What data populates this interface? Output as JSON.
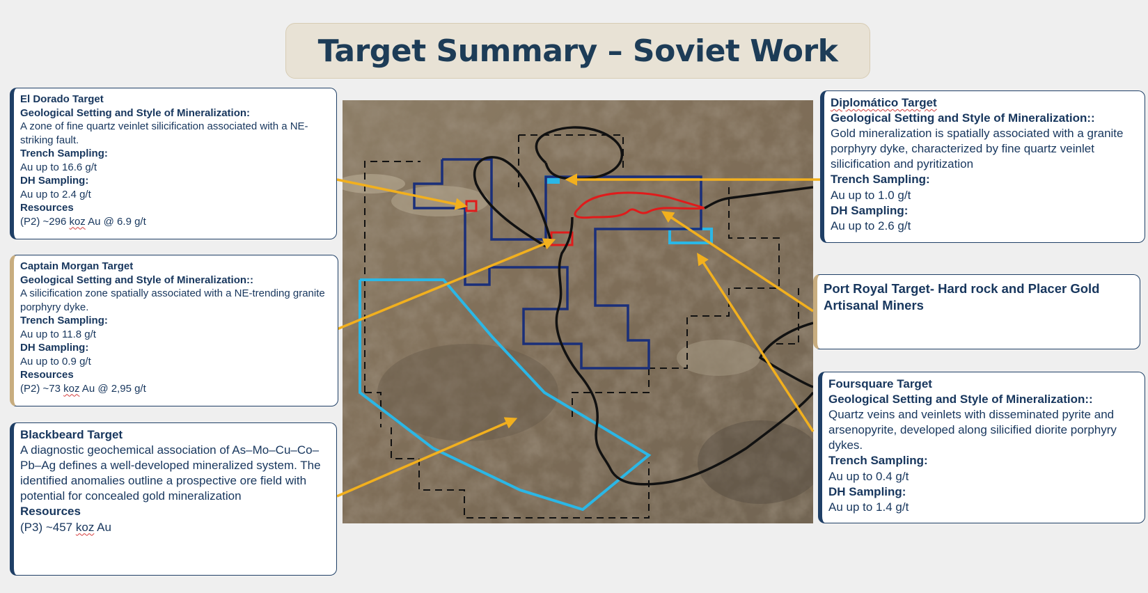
{
  "title": "Target Summary – Soviet Work",
  "el_dorado": {
    "title": "El Dorado Target",
    "h1": "Geological Setting and Style of Mineralization:",
    "p1": "A zone of fine quartz veinlet silicification associated with a NE-striking fault.",
    "h2": "Trench Sampling:",
    "p2": "Au up to 16.6 g/t",
    "h3": "DH Sampling:",
    "p3": "Au up to 2.4 g/t",
    "h4": "Resources",
    "p4_pre": "(P2) ~296 ",
    "p4_koz": "koz",
    "p4_post": " Au @ 6.9 g/t"
  },
  "captain_morgan": {
    "title": "Captain Morgan Target",
    "h1": "Geological Setting and Style of Mineralization::",
    "p1": "A silicification zone spatially associated with a NE-trending granite porphyry dyke.",
    "h2": "Trench Sampling:",
    "p2": "Au up to 11.8 g/t",
    "h3": "DH Sampling:",
    "p3": "Au up to 0.9 g/t",
    "h4": "Resources",
    "p4_pre": "(P2) ~73 ",
    "p4_koz": "koz",
    "p4_post": " Au @ 2,95 g/t"
  },
  "blackbeard": {
    "title": "Blackbeard Target",
    "p1": "A diagnostic geochemical association of As–Mo–Cu–Co–Pb–Ag defines a well-developed mineralized system. The identified anomalies outline a prospective ore field with potential for concealed gold mineralization",
    "h2": "Resources",
    "p2_pre": "(P3) ~457 ",
    "p2_koz": "koz",
    "p2_post": " Au"
  },
  "diplomatico": {
    "title": "Diplomático Target",
    "h1": "Geological Setting and Style of Mineralization::",
    "p1": "Gold mineralization is spatially associated with a granite porphyry dyke, characterized by fine quartz veinlet silicification and pyritization",
    "h2": "Trench Sampling:",
    "p2": "Au up to 1.0 g/t",
    "h3": "DH Sampling:",
    "p3": "Au up to 2.6 g/t"
  },
  "port_royal": {
    "title": "Port Royal Target- Hard rock and Placer Gold Artisanal Miners"
  },
  "foursquare": {
    "title": "Foursquare Target",
    "h1": "Geological Setting and Style of Mineralization::",
    "p1": "Quartz veins and veinlets with disseminated pyrite and arsenopyrite, developed along silicified diorite porphyry dykes.",
    "h2": "Trench Sampling:",
    "p2": "Au up to 0.4 g/t",
    "h3": "DH Sampling:",
    "p3": "Au up to 1.4 g/t"
  },
  "colors": {
    "navy_license": "#1a2f7a",
    "cyan_outline": "#2bb7e6",
    "red_target": "#e01b1b",
    "black_boundary": "#111111",
    "arrow": "#f2b01e"
  }
}
